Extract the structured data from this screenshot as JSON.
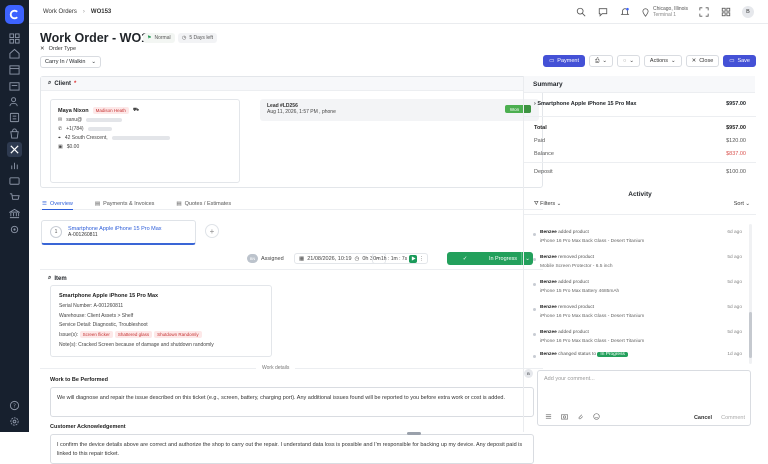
{
  "breadcrumb": {
    "root": "Work Orders",
    "current": "WO153"
  },
  "header": {
    "location": "Chicago, Illinois",
    "terminal": "Terminal 1",
    "avatar_initial": "B"
  },
  "work_order": {
    "title": "Work Order - WO153",
    "priority": "Normal",
    "days_left": "5 Days left",
    "order_type_label": "Order Type",
    "order_type_value": "Carry In / Walkin"
  },
  "toolbar": {
    "payment": "Payment",
    "actions": "Actions",
    "close": "Close",
    "save": "Save"
  },
  "client": {
    "section_title": "Client",
    "name": "Maya Nixon",
    "tag": "Madison Heath",
    "email_prefix": "sanu@",
    "phone": "+1(784)",
    "address": "42 South Crescent, ",
    "balance": "$0.00",
    "lead_title": "Lead #LD256",
    "lead_sub": "Aug 11, 2026, 1:57 PM , phone",
    "lead_status": "Won"
  },
  "tabs": [
    {
      "label": "Overview"
    },
    {
      "label": "Payments & Invoices"
    },
    {
      "label": "Quotes / Estimates"
    }
  ],
  "device_tab": {
    "number": "1",
    "title": "Smartphone Apple iPhone 15 Pro Max",
    "sub": "A-001260811"
  },
  "status_row": {
    "assigned_initials": "BN",
    "assigned": "Assigned",
    "datetime": "21/08/2026, 10:19",
    "duration": "0h 30m",
    "timer": "1h : 1m : 7s",
    "status": "In Progress"
  },
  "item": {
    "section_title": "Item",
    "name": "Smartphone Apple iPhone 15 Pro Max",
    "serial_label": "Serial Number:",
    "serial": "A-001260811",
    "warehouse_label": "Warehouse:",
    "warehouse": "Client Assets > Shelf",
    "service_label": "Service Detail:",
    "service": "Diagnostic, Troubleshoot",
    "issues_label": "Issue(s):",
    "issues": [
      "Screen flicker",
      "Shattered glass",
      "Shutdown Randomly"
    ],
    "notes_label": "Note(s):",
    "notes": "Cracked Screen because of damage and shutdown randomly"
  },
  "work_details": {
    "divider": "Work details",
    "perform_title": "Work to Be Performed",
    "perform_text": "We will diagnose and repair the issue described on this ticket (e.g., screen, battery, charging port). Any additional issues found will be reported to you before extra work or cost is added.",
    "ack_title": "Customer Acknowledgement",
    "ack_text": "I confirm the device details above are correct and authorize the shop to carry out the repair. I understand data loss is possible and I'm responsible for backing up my device. Any deposit paid is linked to this repair ticket."
  },
  "summary": {
    "title": "Summary",
    "item": "Smartphone Apple iPhone 15 Pro Max",
    "item_price": "$957.00",
    "rows": [
      {
        "label": "Total",
        "value": "$957.00"
      },
      {
        "label": "Paid",
        "value": "$120.00"
      },
      {
        "label": "Balance",
        "value": "$837.00"
      },
      {
        "label": "Deposit",
        "value": "$100.00"
      }
    ]
  },
  "activity": {
    "title": "Activity",
    "filters": "Filters",
    "sort": "Sort",
    "items": [
      {
        "user": "Benzee",
        "action": "added product",
        "detail": "iPhone 16 Pro Max Back Glass - Desert Titanium",
        "ago": "6d ago"
      },
      {
        "user": "Benzee",
        "action": "removed product",
        "detail": "Mobile Screen Protector - 6.5 inch",
        "ago": "5d ago"
      },
      {
        "user": "Benzee",
        "action": "added product",
        "detail": "iPhone 15 Pro Max Battery 4685mAh",
        "ago": "5d ago"
      },
      {
        "user": "Benzee",
        "action": "removed product",
        "detail": "iPhone 16 Pro Max Back Glass - Desert Titanium",
        "ago": "5d ago"
      },
      {
        "user": "Benzee",
        "action": "added product",
        "detail": "iPhone 16 Pro Max Back Glass - Desert Titanium",
        "ago": "5d ago"
      },
      {
        "user": "Benzee",
        "action": "changed status to",
        "status": "In Progress",
        "ago": "1d ago"
      }
    ],
    "comment_avatar": "B",
    "comment_placeholder": "Add your comment...",
    "cancel": "Cancel",
    "comment": "Comment"
  }
}
